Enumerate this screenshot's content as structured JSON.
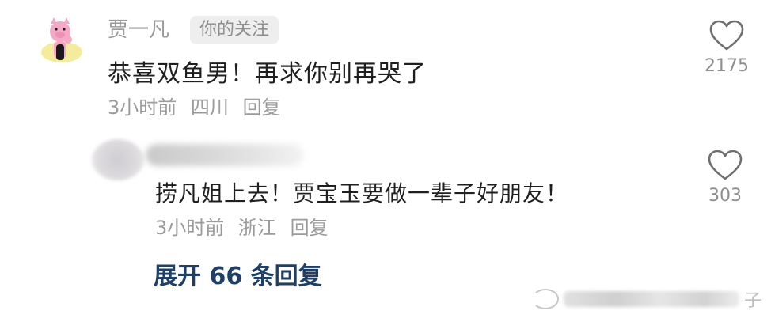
{
  "main_comment": {
    "avatar_icon": "pink-pig-hug-avatar",
    "username": "贾一凡",
    "badge": "你的关注",
    "text": "恭喜双鱼男！再求你别再哭了",
    "time": "3小时前",
    "location": "四川",
    "reply_label": "回复",
    "like_icon": "heart-outline-icon",
    "like_count": "2175"
  },
  "reply": {
    "avatar_icon": "blurred-avatar",
    "text": "捞凡姐上去！贾宝玉要做一辈子好朋友！",
    "time": "3小时前",
    "location": "浙江",
    "reply_label": "回复",
    "like_icon": "heart-outline-icon",
    "like_count": "303"
  },
  "expand": {
    "label": "展开 66 条回复"
  },
  "watermark": {
    "visible_char": "子"
  }
}
